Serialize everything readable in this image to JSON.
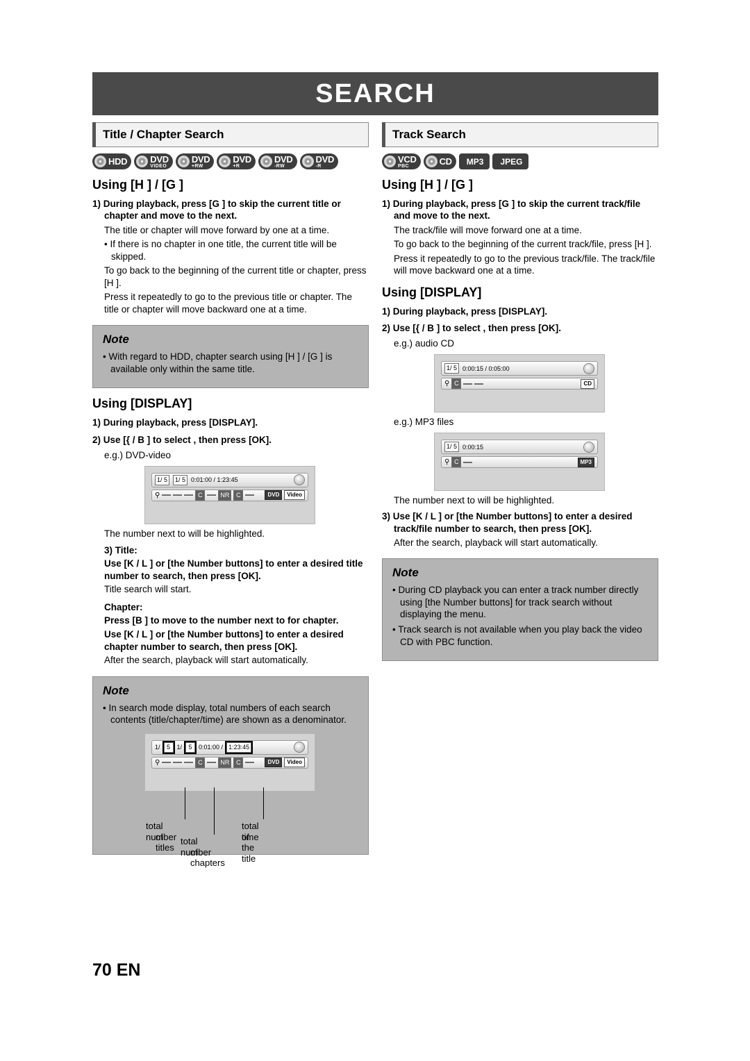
{
  "header": {
    "title": "SEARCH"
  },
  "footer": {
    "page": "70 EN"
  },
  "left": {
    "section_title": "Title / Chapter Search",
    "logos": [
      {
        "name": "HDD",
        "main": "HDD",
        "sub": ""
      },
      {
        "name": "DVD-Video",
        "main": "DVD",
        "sub": "VIDEO"
      },
      {
        "name": "DVD+RW",
        "main": "DVD",
        "sub": "+RW"
      },
      {
        "name": "DVD+R",
        "main": "DVD",
        "sub": "+R"
      },
      {
        "name": "DVD-RW",
        "main": "DVD",
        "sub": "-RW"
      },
      {
        "name": "DVD-R",
        "main": "DVD",
        "sub": "-R"
      }
    ],
    "using_keys_heading": "Using [H    ] / [G    ]",
    "step1": "1) During playback, press [G    ] to skip the current title or chapter and move to the next.",
    "p1": "The title or chapter will move forward by one at a time.",
    "b1": "• If there is no chapter in one title, the current title will be skipped.",
    "p2": "To go back to the beginning of the current title or chapter, press [H    ].",
    "p3": "Press it repeatedly to go to the previous title or chapter. The title or chapter will move backward one at a time.",
    "note1": {
      "title": "Note",
      "items": [
        "• With regard to HDD, chapter search using [H    ] / [G    ] is available only within the same title."
      ]
    },
    "using_display_heading": "Using [DISPLAY]",
    "d_step1": "1) During playback, press [DISPLAY].",
    "d_step2": "2) Use [{    / B ] to select       , then press [OK].",
    "eg": "e.g.) DVD-video",
    "osd": {
      "f1": "1/ 5",
      "f2": "1/ 5",
      "time": "0:01:00 / 1:23:45",
      "tag1": "DVD",
      "tag2": "Video"
    },
    "after_osd": "The number next to          will be highlighted.",
    "t_step3": "3) Title:",
    "t_step3_body": "Use [K  / L ] or [the Number buttons] to enter a desired title number to search, then press [OK].",
    "t_step3_note": "Title search will start.",
    "chapter_label": "Chapter:",
    "chapter_body1": "Press [B ] to move to the number next to        for chapter.",
    "chapter_body2": "Use [K  / L ] or [the Number buttons] to enter a desired chapter number to search, then press [OK].",
    "chapter_after": "After the search, playback will start automatically.",
    "note2": {
      "title": "Note",
      "items": [
        "• In search mode display, total numbers of each search contents (title/chapter/time) are shown as a denominator."
      ],
      "osd": {
        "f1a": "1/",
        "f1b": "5",
        "f2a": "1/",
        "f2b": "5",
        "time_a": "0:01:00 /",
        "time_b": "1:23:45",
        "tag1": "DVD",
        "tag2": "Video"
      },
      "callouts": {
        "c1_l1": "total number",
        "c1_l2": "of titles",
        "c2_l1": "total number",
        "c2_l2": "of chapters",
        "c3_l1": "total time",
        "c3_l2": "of the title"
      }
    }
  },
  "right": {
    "section_title": "Track Search",
    "logos": [
      {
        "name": "VCD",
        "main": "VCD",
        "sub": "PBC"
      },
      {
        "name": "CD",
        "main": "CD",
        "sub": ""
      },
      {
        "name": "MP3",
        "main": "MP3",
        "sub": ""
      },
      {
        "name": "JPEG",
        "main": "JPEG",
        "sub": ""
      }
    ],
    "using_keys_heading": "Using [H    ] / [G    ]",
    "step1": "1) During playback, press [G    ] to skip the current track/file and move to the next.",
    "p1": "The track/file will move forward one at a time.",
    "p2": "To go back to the beginning of the current track/file, press [H    ].",
    "p3": "Press it repeatedly to go to the previous track/file. The track/file will move backward one at a time.",
    "using_display_heading": "Using [DISPLAY]",
    "d_step1": "1) During playback, press [DISPLAY].",
    "d_step2": "2) Use [{    / B ] to select       , then press [OK].",
    "eg1": "e.g.) audio CD",
    "osd_cd": {
      "f1": "1/ 5",
      "time": "0:00:15 / 0:05:00",
      "tag": "CD"
    },
    "eg2": "e.g.) MP3 files",
    "osd_mp3": {
      "f1": "1/ 5",
      "time": "0:00:15",
      "tag": "MP3"
    },
    "after_osd": "The number next to          will be highlighted.",
    "step3": "3) Use [K  / L ] or [the Number buttons] to enter a desired track/file number to search, then press [OK].",
    "step3_after": "After the search, playback will start automatically.",
    "note": {
      "title": "Note",
      "items": [
        "• During CD playback you can enter a track number directly using [the Number buttons] for track search without displaying the menu.",
        "• Track search is not available when you play back the video CD with PBC function."
      ]
    }
  }
}
